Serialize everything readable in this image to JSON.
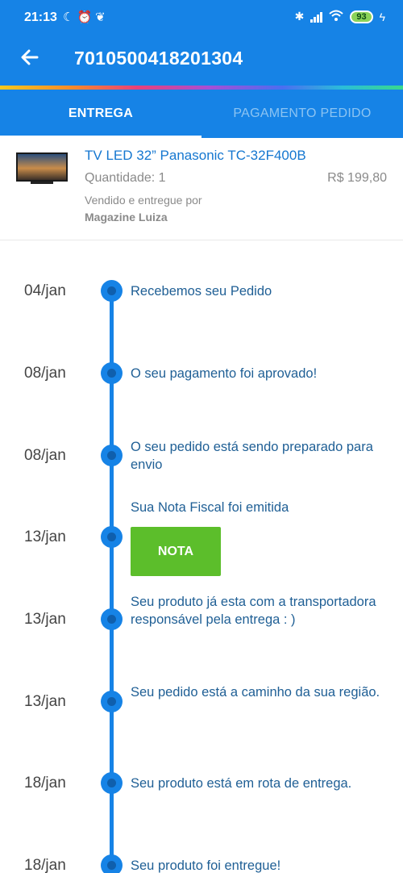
{
  "status_bar": {
    "time": "21:13",
    "battery": "93",
    "icons_left": [
      "moon-icon",
      "alarm-icon",
      "leaf-icon"
    ],
    "icons_right": [
      "bluetooth-icon",
      "signal-icon",
      "wifi-icon",
      "battery-icon",
      "charging-icon"
    ]
  },
  "header": {
    "order_number": "7010500418201304"
  },
  "tabs": [
    {
      "label": "ENTREGA",
      "active": true
    },
    {
      "label": "PAGAMENTO PEDIDO",
      "active": false
    }
  ],
  "product": {
    "name": "TV LED 32” Panasonic TC-32F400B",
    "quantity": "Quantidade: 1",
    "price": "R$ 199,80",
    "sold_by": "Vendido e entregue por",
    "seller": "Magazine Luiza"
  },
  "timeline": [
    {
      "date": "04/jan",
      "message": "Recebemos seu Pedido"
    },
    {
      "date": "08/jan",
      "message": "O seu pagamento foi aprovado!"
    },
    {
      "date": "08/jan",
      "message": "O seu pedido está sendo preparado para envio"
    },
    {
      "date": "13/jan",
      "message": "Sua Nota Fiscal foi emitida",
      "button": "NOTA"
    },
    {
      "date": "13/jan",
      "message": "Seu produto já esta com a transportadora responsável pela entrega : )"
    },
    {
      "date": "13/jan",
      "message": "Seu pedido está a caminho da sua região."
    },
    {
      "date": "18/jan",
      "message": "Seu produto está em rota de entrega."
    },
    {
      "date": "18/jan",
      "message": "Seu produto foi entregue!"
    }
  ],
  "colors": {
    "primary": "#1683e6",
    "note_button": "#5cbe2b",
    "message_text": "#1f5f95"
  }
}
